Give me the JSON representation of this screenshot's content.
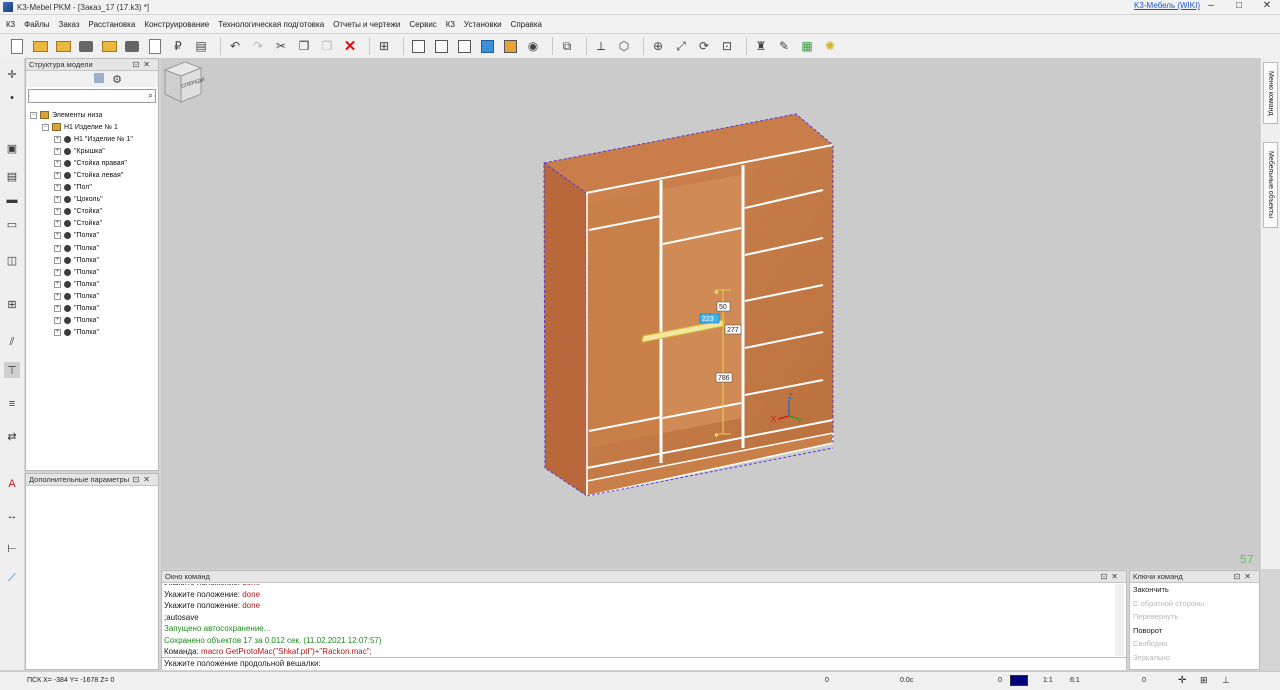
{
  "window": {
    "title": "K3-Mebel PKM - [Заказ_17 (17.k3) *]",
    "wiki_link": "K3-Мебель (WIKI)",
    "buttons": [
      "–",
      "□",
      "✕"
    ]
  },
  "menu": [
    "К3",
    "Файлы",
    "Заказ",
    "Расстановка",
    "Конструирование",
    "Технологическая подготовка",
    "Отчеты и чертежи",
    "Сервис",
    "К3",
    "Установки",
    "Справка"
  ],
  "toolbar_icons": [
    "new-doc-icon",
    "open-folder-icon",
    "open-folder-2-icon",
    "save-icon",
    "save-folder-icon",
    "print-icon",
    "preview-icon",
    "price-icon",
    "table-icon",
    "undo-icon",
    "redo-icon",
    "cut-icon",
    "copy-icon",
    "paste-icon",
    "delete-icon",
    "grid-icon",
    "cube-wire-icon",
    "cube-hidden-icon",
    "cube-shade-icon",
    "cube-blue-icon",
    "cube-texture-icon",
    "viewpoint-icon",
    "layers-icon",
    "axes-icon",
    "cube-3d-icon",
    "zoom-in-icon",
    "zoom-window-icon",
    "zoom-all-icon",
    "zoom-box-icon",
    "brush-icon",
    "picker-icon",
    "palette-icon",
    "light-icon"
  ],
  "structure_panel": {
    "title": "Структура модели",
    "search_placeholder": "",
    "tree": [
      {
        "label": "Элементы низа",
        "level": 0,
        "icon": "folder"
      },
      {
        "label": "Н1 Изделие № 1",
        "level": 1,
        "icon": "folder"
      },
      {
        "label": "Н1 \"Изделие № 1\"",
        "level": 2,
        "icon": "box"
      },
      {
        "label": "\"Крышка\"",
        "level": 2,
        "icon": "box"
      },
      {
        "label": "\"Стойка правая\"",
        "level": 2,
        "icon": "box"
      },
      {
        "label": "\"Стойка левая\"",
        "level": 2,
        "icon": "box"
      },
      {
        "label": "\"Пол\"",
        "level": 2,
        "icon": "box"
      },
      {
        "label": "\"Цоколь\"",
        "level": 2,
        "icon": "box"
      },
      {
        "label": "\"Стойка\"",
        "level": 2,
        "icon": "box"
      },
      {
        "label": "\"Стойка\"",
        "level": 2,
        "icon": "box"
      },
      {
        "label": "\"Полка\"",
        "level": 2,
        "icon": "box"
      },
      {
        "label": "\"Полка\"",
        "level": 2,
        "icon": "box"
      },
      {
        "label": "\"Полка\"",
        "level": 2,
        "icon": "box"
      },
      {
        "label": "\"Полка\"",
        "level": 2,
        "icon": "box"
      },
      {
        "label": "\"Полка\"",
        "level": 2,
        "icon": "box"
      },
      {
        "label": "\"Полка\"",
        "level": 2,
        "icon": "box"
      },
      {
        "label": "\"Полка\"",
        "level": 2,
        "icon": "box"
      },
      {
        "label": "\"Полка\"",
        "level": 2,
        "icon": "box"
      },
      {
        "label": "\"Полка\"",
        "level": 2,
        "icon": "box"
      }
    ]
  },
  "extra_panel": {
    "title": "Дополнительные параметры"
  },
  "viewport": {
    "navcube_label": "СПЕРЕДИ",
    "view_number": "57",
    "dimensions": [
      "50",
      "223",
      "277",
      "786"
    ],
    "axis_labels": [
      "X",
      "Y",
      "Z"
    ]
  },
  "side_tabs": [
    "Меню команд",
    "Мебельные объекты"
  ],
  "command_window": {
    "title": "Окно команд",
    "lines": [
      {
        "prefix": "Укажите положение: ",
        "value": "done",
        "style": "partial"
      },
      {
        "prefix": "Укажите положение: ",
        "value": "done",
        "style": "normal"
      },
      {
        "prefix": "Укажите положение: ",
        "value": "done",
        "style": "normal"
      },
      {
        "prefix": ";autosave",
        "value": "",
        "style": "normal"
      },
      {
        "prefix": "Запущено автосохранение...",
        "value": "",
        "style": "green"
      },
      {
        "prefix": "Сохранено объектов 17 за 0.012 сек. (11.02.2021 12:07:57)",
        "value": "",
        "style": "green"
      },
      {
        "prefix": "Команда: ",
        "value": "macro GetProtoMac(\"Shkaf.ptl\")+\"Rackon.mac\";",
        "style": "cmd"
      }
    ],
    "prompt": "Укажите положение продольной вешалки:"
  },
  "keys_panel": {
    "title": "Ключи команд",
    "items": [
      {
        "label": "Закончить",
        "enabled": true
      },
      {
        "label": "С обратной стороны",
        "enabled": false
      },
      {
        "label": "Перевернуть",
        "enabled": false
      },
      {
        "label": "Поворот",
        "enabled": true
      },
      {
        "label": "Свободно",
        "enabled": false
      },
      {
        "label": "Зеркально",
        "enabled": false
      }
    ]
  },
  "statusbar": {
    "coords": "ПСК X= -384    Y= -1678    Z=   0",
    "field1": "0",
    "field2": "0.0с",
    "field3": "0",
    "scale1": "1:1",
    "scale2": "6:1",
    "field4": "0",
    "accent": "#00007a"
  },
  "colors": {
    "wood": "#c87a47",
    "wood_dark": "#a8602f",
    "selection": "#5a3cd0",
    "dimension": "#e8c84a"
  }
}
